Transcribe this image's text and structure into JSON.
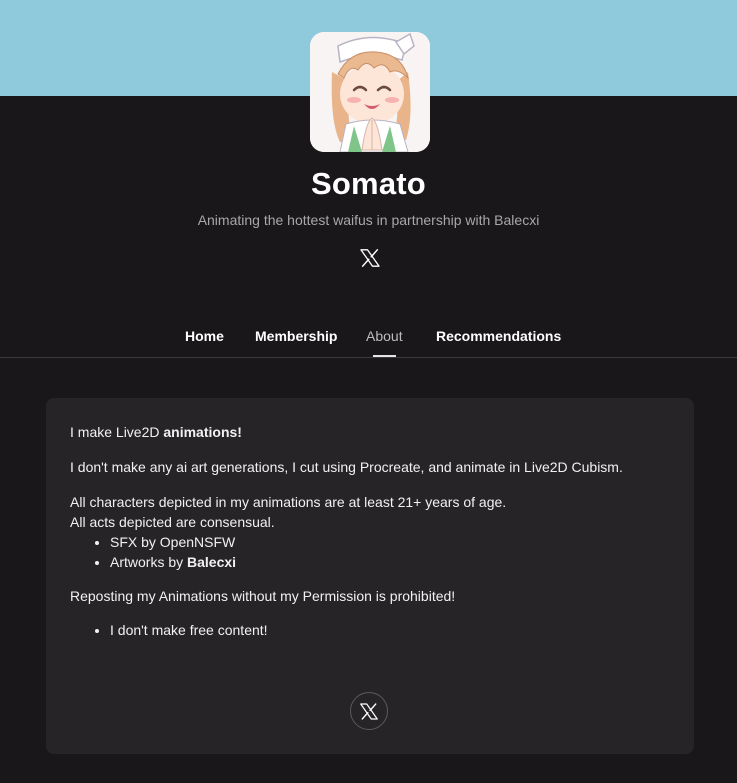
{
  "creator": {
    "name": "Somato",
    "tagline": "Animating the hottest waifus in partnership with Balecxi"
  },
  "social": {
    "top_icon": "x-logo-icon",
    "card_icon": "x-logo-icon"
  },
  "nav": {
    "items": [
      {
        "label": "Home"
      },
      {
        "label": "Membership"
      },
      {
        "label": "About"
      },
      {
        "label": "Recommendations"
      }
    ],
    "active": "About"
  },
  "about": {
    "line1_prefix": "I make Live2D ",
    "line1_bold": "animations!",
    "line2": "I don't make any ai art generations, I cut using Procreate, and animate in Live2D Cubism.",
    "line3": "All characters depicted in my animations are at least 21+ years of age.",
    "line4": "All acts depicted are consensual.",
    "bullets1": [
      {
        "prefix": "SFX by OpenNSFW",
        "bold": ""
      },
      {
        "prefix": "Artworks by ",
        "bold": "Balecxi"
      }
    ],
    "line5": "Reposting my Animations without my Permission is prohibited!",
    "bullets2": [
      {
        "prefix": "I don't make free content!",
        "bold": ""
      }
    ]
  },
  "colors": {
    "banner": "#8ec9dc",
    "page_bg": "#19171a",
    "card_bg": "#262427",
    "tagline": "#a9a7aa"
  }
}
